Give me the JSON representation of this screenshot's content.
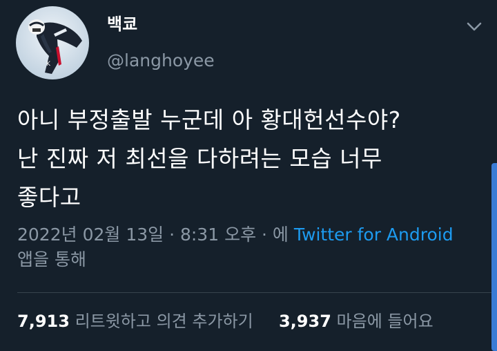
{
  "author": {
    "display_name": "백쿄",
    "handle": "@langhoyee"
  },
  "tweet": {
    "lines": [
      "아니 부정출발 누군데 아 황대헌선수야?",
      "난 진짜 저 최선을 다하려는 모습 너무",
      "좋다고"
    ],
    "timestamp": "2022년 02월 13일 · 8:31 오후 · 에",
    "source": "Twitter for Android",
    "source_suffix": "앱을 통해"
  },
  "stats": {
    "retweets_count": "7,913",
    "retweets_label": "리트윗하고 의견 추가하기",
    "likes_count": "3,937",
    "likes_label": "마음에 들어요"
  },
  "icons": {
    "caret": "chevron-down-icon",
    "avatar": "avatar"
  },
  "colors": {
    "background": "#15202b",
    "text_primary": "#ffffff",
    "text_secondary": "#8b98a5",
    "link": "#1d9bf0",
    "divider": "#38444d"
  }
}
